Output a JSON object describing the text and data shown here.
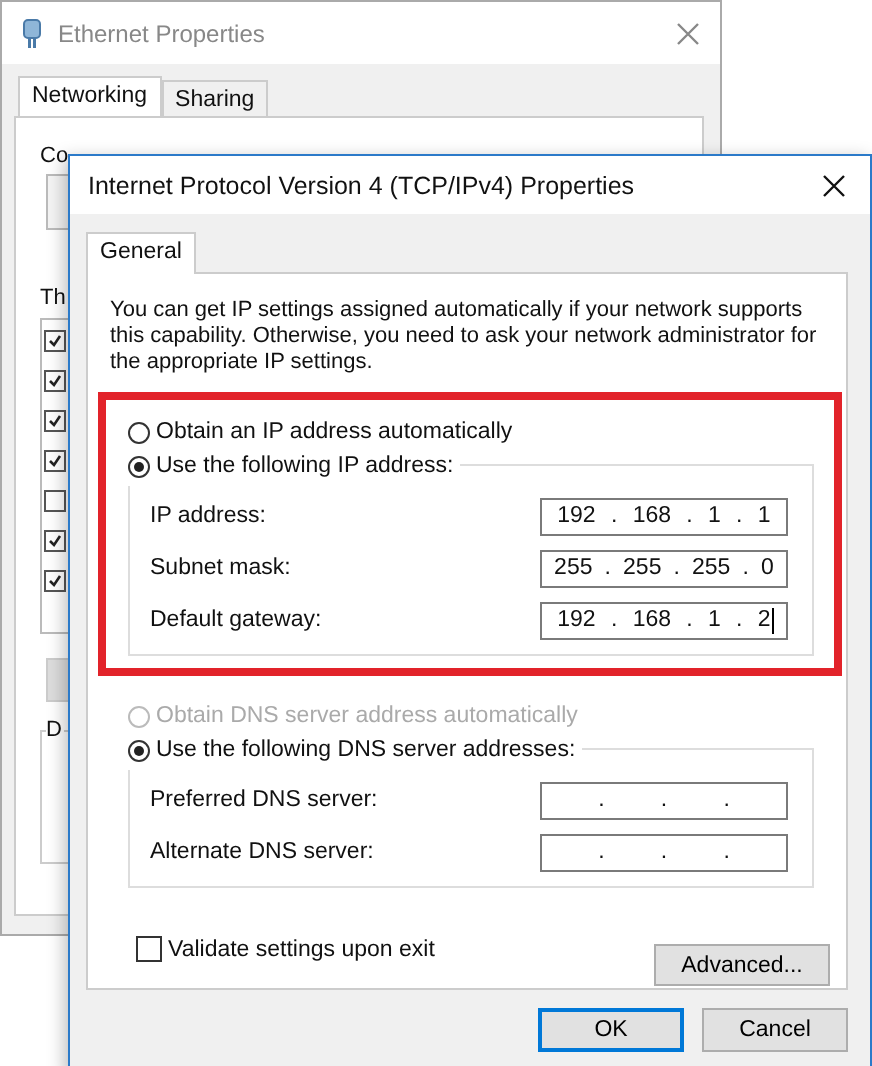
{
  "back_window": {
    "title": "Ethernet Properties",
    "tabs": [
      {
        "label": "Networking",
        "selected": true
      },
      {
        "label": "Sharing",
        "selected": false
      }
    ],
    "connect_label": "Co",
    "list_label": "Th",
    "components": [
      {
        "checked": true
      },
      {
        "checked": true
      },
      {
        "checked": true
      },
      {
        "checked": true
      },
      {
        "checked": false
      },
      {
        "checked": true
      },
      {
        "checked": true
      }
    ],
    "description_label": "D"
  },
  "dialog": {
    "title": "Internet Protocol Version 4 (TCP/IPv4) Properties",
    "tabs": [
      {
        "label": "General",
        "selected": true
      }
    ],
    "intro": "You can get IP settings assigned automatically if your network supports this capability. Otherwise, you need to ask your network administrator for the appropriate IP settings.",
    "ip_group": {
      "highlighted": true,
      "options": [
        {
          "label": "Obtain an IP address automatically",
          "selected": false,
          "disabled": false
        },
        {
          "label": "Use the following IP address:",
          "selected": true,
          "disabled": false
        }
      ],
      "fields": [
        {
          "label": "IP address:",
          "segments": [
            "192",
            ".",
            "168",
            ".",
            "1",
            ".",
            "1"
          ]
        },
        {
          "label": "Subnet mask:",
          "segments": [
            "255",
            ".",
            "255",
            ".",
            "255",
            ".",
            "0"
          ]
        },
        {
          "label": "Default gateway:",
          "segments": [
            "192",
            ".",
            "168",
            ".",
            "1",
            ".",
            "2"
          ],
          "focused": true
        }
      ]
    },
    "dns_group": {
      "highlighted": false,
      "options": [
        {
          "label": "Obtain DNS server address automatically",
          "selected": false,
          "disabled": true
        },
        {
          "label": "Use the following DNS server addresses:",
          "selected": true,
          "disabled": false
        }
      ],
      "fields": [
        {
          "label": "Preferred DNS server:",
          "segments": [
            ".",
            ".",
            "."
          ]
        },
        {
          "label": "Alternate DNS server:",
          "segments": [
            ".",
            ".",
            "."
          ]
        }
      ]
    },
    "validate": {
      "label": "Validate settings upon exit",
      "checked": false
    },
    "advanced_button": "Advanced...",
    "buttons": [
      {
        "label": "OK",
        "default": true
      },
      {
        "label": "Cancel",
        "default": false
      }
    ]
  }
}
